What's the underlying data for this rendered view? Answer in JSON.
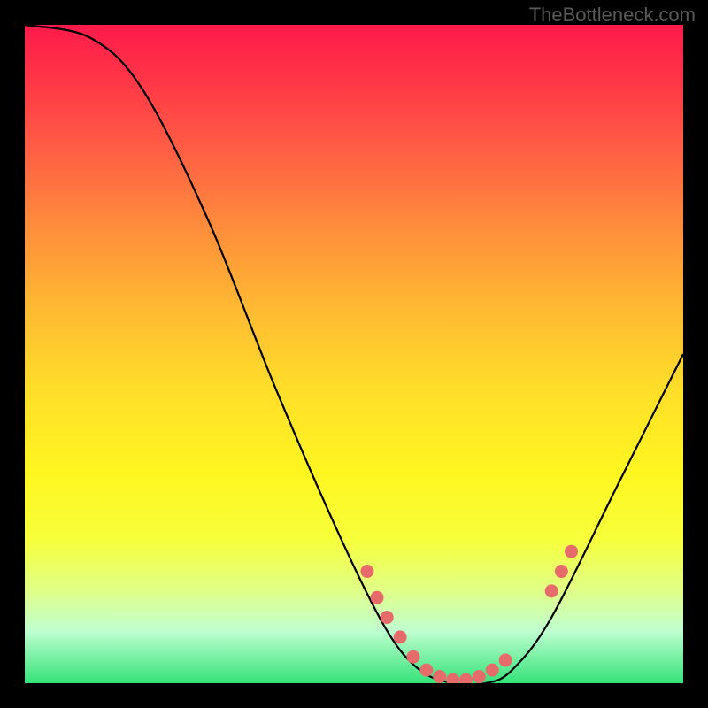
{
  "attribution": "TheBottleneck.com",
  "chart_data": {
    "type": "line",
    "title": "",
    "xlabel": "",
    "ylabel": "",
    "xlim": [
      0,
      100
    ],
    "ylim": [
      0,
      100
    ],
    "curve_points": [
      {
        "x": 0,
        "y": 100
      },
      {
        "x": 10,
        "y": 98
      },
      {
        "x": 18,
        "y": 90
      },
      {
        "x": 28,
        "y": 70
      },
      {
        "x": 38,
        "y": 45
      },
      {
        "x": 48,
        "y": 22
      },
      {
        "x": 55,
        "y": 8
      },
      {
        "x": 60,
        "y": 2
      },
      {
        "x": 65,
        "y": 0
      },
      {
        "x": 70,
        "y": 0
      },
      {
        "x": 74,
        "y": 2
      },
      {
        "x": 80,
        "y": 10
      },
      {
        "x": 90,
        "y": 30
      },
      {
        "x": 100,
        "y": 50
      }
    ],
    "marker_points": [
      {
        "x": 52,
        "y": 17
      },
      {
        "x": 53.5,
        "y": 13
      },
      {
        "x": 55,
        "y": 10
      },
      {
        "x": 57,
        "y": 7
      },
      {
        "x": 59,
        "y": 4
      },
      {
        "x": 61,
        "y": 2
      },
      {
        "x": 63,
        "y": 1
      },
      {
        "x": 65,
        "y": 0.5
      },
      {
        "x": 67,
        "y": 0.5
      },
      {
        "x": 69,
        "y": 1
      },
      {
        "x": 71,
        "y": 2
      },
      {
        "x": 73,
        "y": 3.5
      },
      {
        "x": 80,
        "y": 14
      },
      {
        "x": 81.5,
        "y": 17
      },
      {
        "x": 83,
        "y": 20
      }
    ],
    "marker_color": "#e86b6b",
    "curve_color": "#000000",
    "gradient_stops": [
      {
        "pos": 0,
        "color": "#ff1a4a"
      },
      {
        "pos": 100,
        "color": "#35e27a"
      }
    ]
  }
}
